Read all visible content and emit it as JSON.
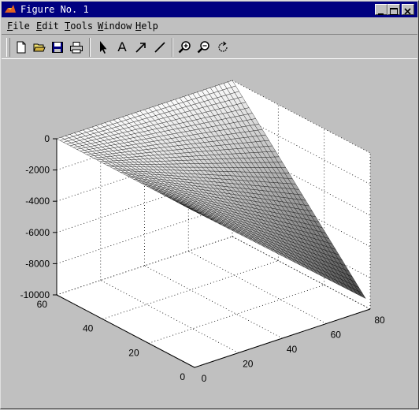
{
  "window": {
    "title": "Figure No. 1",
    "controls": [
      "minimize",
      "maximize",
      "close"
    ]
  },
  "menu": [
    {
      "label": "File",
      "accel": "F"
    },
    {
      "label": "Edit",
      "accel": "E"
    },
    {
      "label": "Tools",
      "accel": "T"
    },
    {
      "label": "Window",
      "accel": "W"
    },
    {
      "label": "Help",
      "accel": "H"
    }
  ],
  "toolbar": {
    "items": [
      "new-file-icon",
      "open-folder-icon",
      "save-icon",
      "print-icon",
      "select-arrow-icon",
      "text-tool-icon",
      "arrow-tool-icon",
      "line-tool-icon",
      "zoom-in-icon",
      "zoom-out-icon",
      "rotate-3d-icon"
    ],
    "text_tool_label": "A"
  },
  "chart_data": {
    "type": "surface",
    "title": "",
    "xlabel": "",
    "ylabel": "",
    "zlabel": "",
    "x_ticks": [
      "0",
      "20",
      "40",
      "60",
      "80"
    ],
    "y_ticks": [
      "0",
      "20",
      "40",
      "60"
    ],
    "z_ticks": [
      "0",
      "-2000",
      "-4000",
      "-6000",
      "-8000",
      "-10000"
    ],
    "xlim": [
      0,
      80
    ],
    "ylim": [
      0,
      60
    ],
    "zlim": [
      -10000,
      0
    ],
    "grid": "on",
    "colormap": "gray",
    "colors": {
      "background": "#c0c0c0",
      "axes_bg": "#ffffff",
      "titlebar": "#000080"
    }
  }
}
